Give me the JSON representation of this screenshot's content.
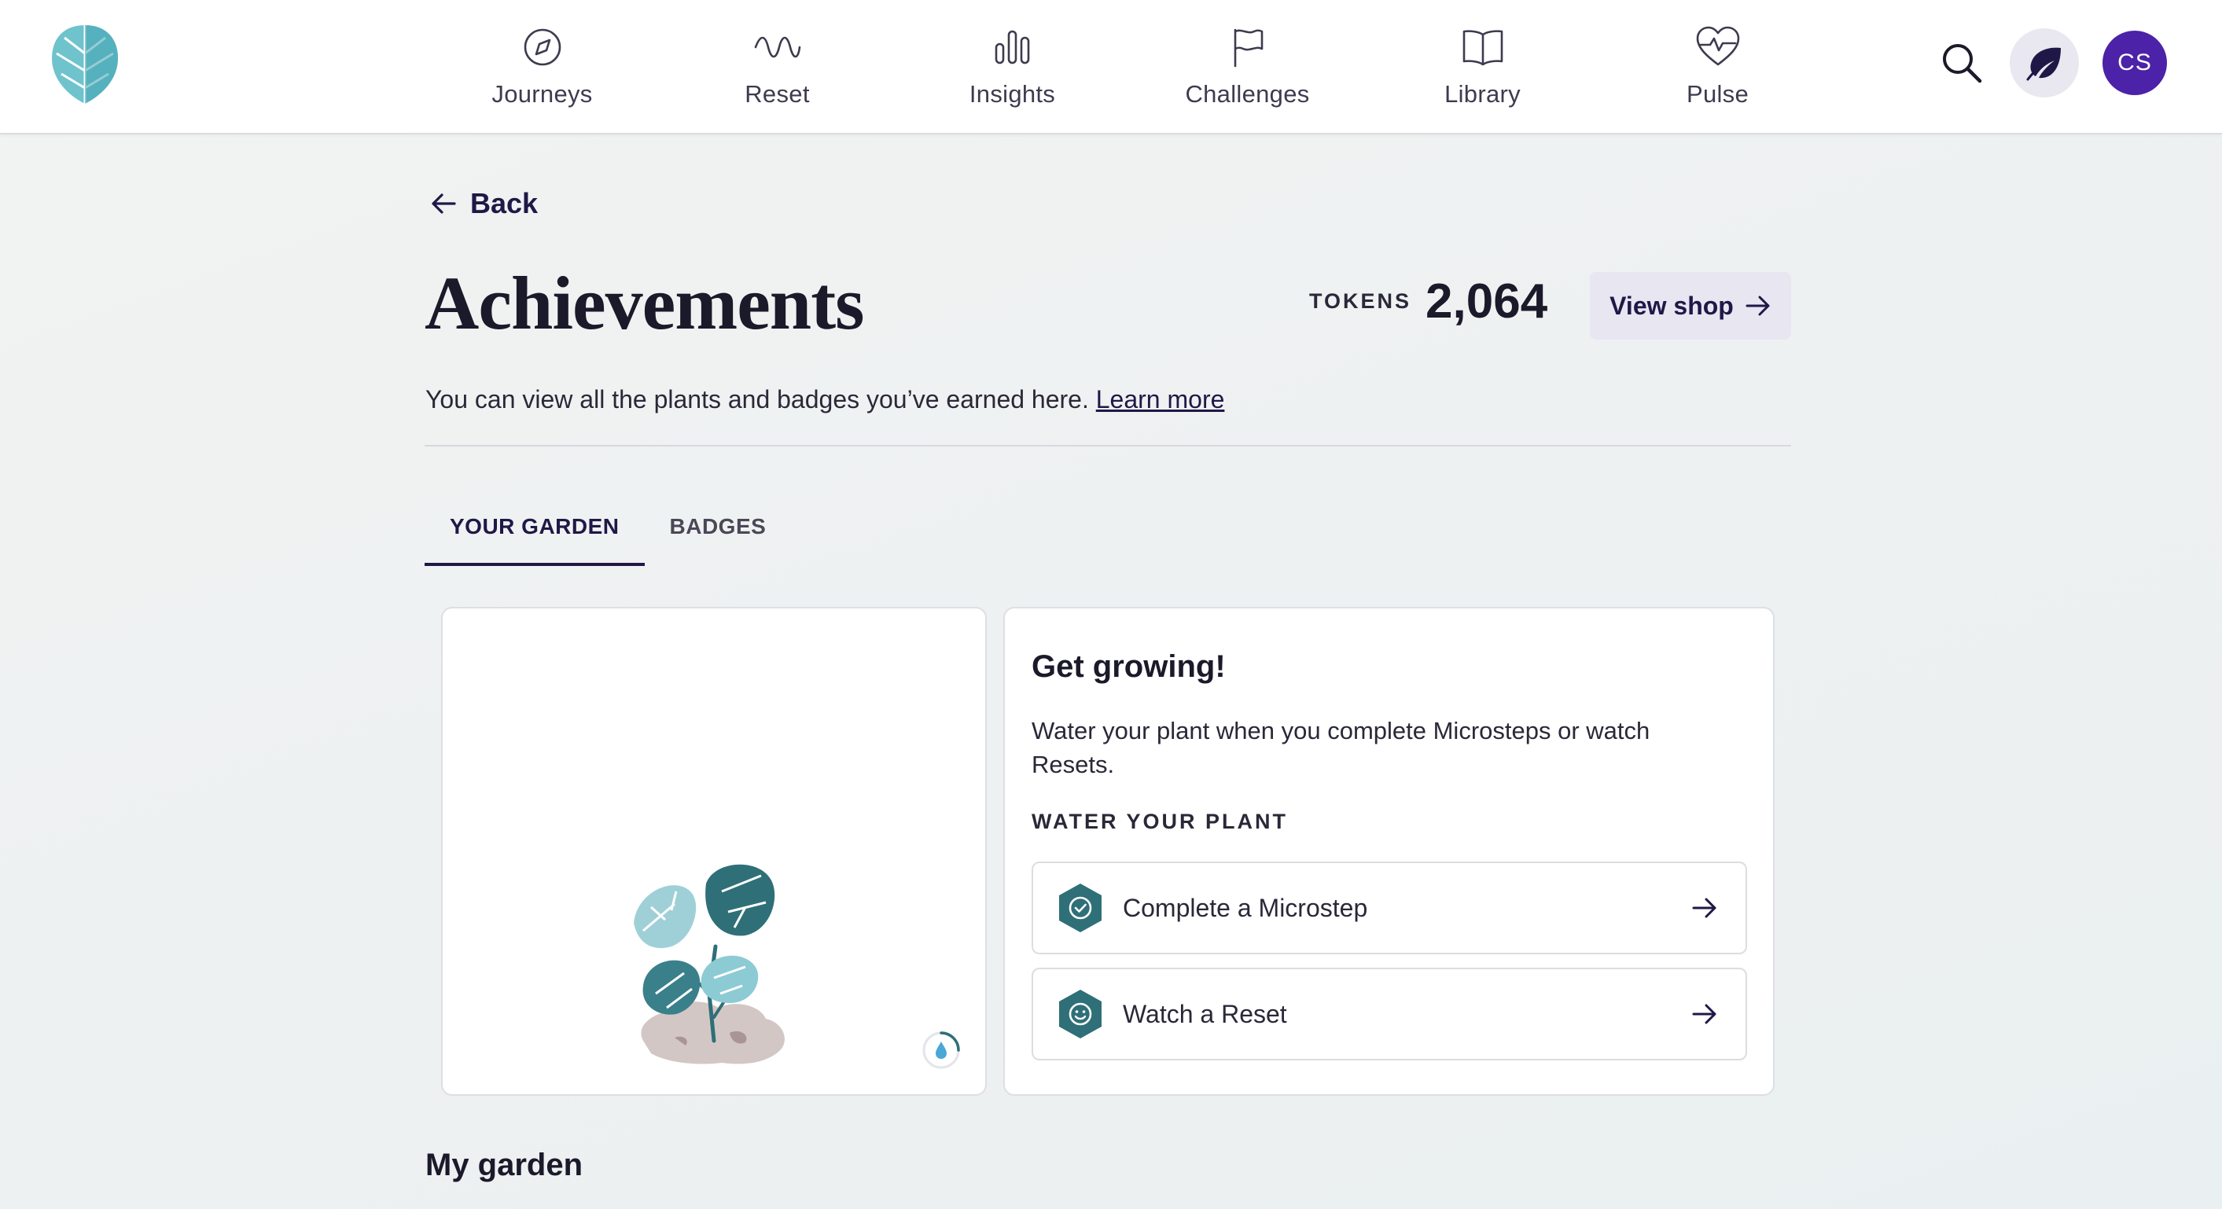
{
  "nav": {
    "items": [
      {
        "label": "Journeys",
        "icon": "compass-icon"
      },
      {
        "label": "Reset",
        "icon": "wave-icon"
      },
      {
        "label": "Insights",
        "icon": "bar-chart-icon"
      },
      {
        "label": "Challenges",
        "icon": "flag-icon"
      },
      {
        "label": "Library",
        "icon": "book-icon"
      },
      {
        "label": "Pulse",
        "icon": "heart-pulse-icon"
      }
    ],
    "avatar_initials": "CS"
  },
  "header": {
    "back_label": "Back",
    "title": "Achievements",
    "tokens_label": "TOKENS",
    "tokens_value": "2,064",
    "shop_label": "View shop"
  },
  "intro": {
    "text": "You can view all the plants and badges you’ve earned here.",
    "link": "Learn more"
  },
  "tabs": [
    {
      "label": "YOUR GARDEN",
      "active": true
    },
    {
      "label": "BADGES",
      "active": false
    }
  ],
  "grow": {
    "title": "Get growing!",
    "description": "Water your plant when you complete Microsteps or watch Resets.",
    "section_label": "WATER YOUR PLANT",
    "actions": [
      {
        "label": "Complete a Microstep",
        "icon": "check-hex-icon"
      },
      {
        "label": "Watch a Reset",
        "icon": "smile-hex-icon"
      }
    ]
  },
  "garden": {
    "heading": "My garden"
  },
  "colors": {
    "brand_dark": "#1f1847",
    "avatar_bg": "#4b22a8",
    "teal": "#2f6f78",
    "teal_light": "#8ccbd4"
  }
}
